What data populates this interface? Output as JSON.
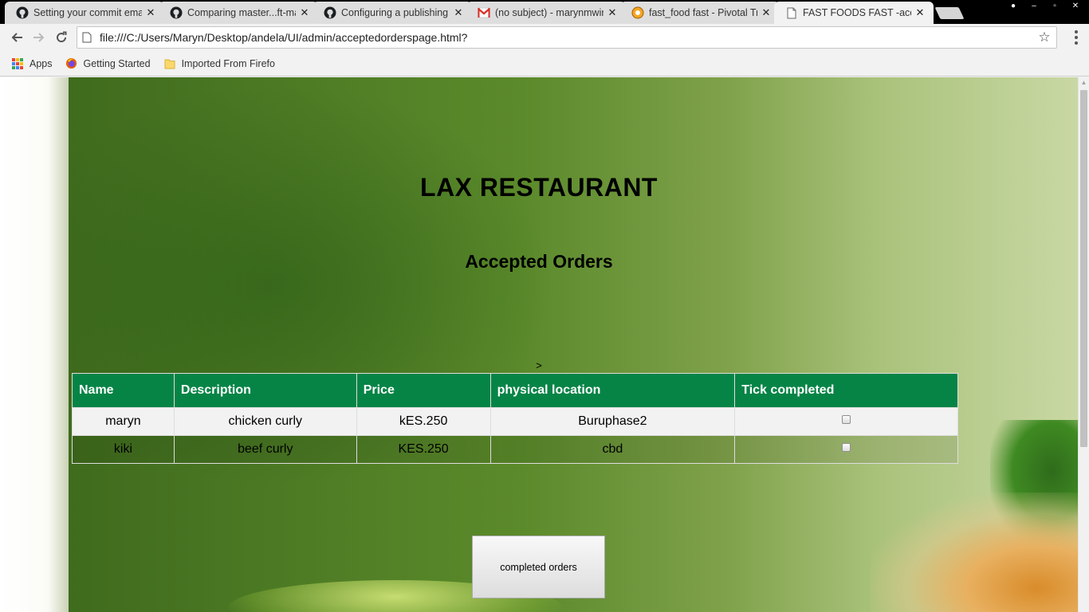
{
  "browser": {
    "tabs": [
      {
        "title": "Setting your commit ema",
        "icon": "github-icon"
      },
      {
        "title": "Comparing master...ft-ma",
        "icon": "github-icon"
      },
      {
        "title": "Configuring a publishing",
        "icon": "github-icon"
      },
      {
        "title": "(no subject) - marynmwir",
        "icon": "gmail-icon"
      },
      {
        "title": "fast_food fast - Pivotal Tr",
        "icon": "pivotal-icon"
      },
      {
        "title": "FAST FOODS FAST -acce",
        "icon": "page-icon"
      }
    ],
    "url": "file:///C:/Users/Maryn/Desktop/andela/UI/admin/acceptedorderspage.html?",
    "bookmarks": [
      {
        "label": "Apps",
        "icon": "apps-grid-icon"
      },
      {
        "label": "Getting Started",
        "icon": "firefox-icon"
      },
      {
        "label": "Imported From Firefo",
        "icon": "folder-icon"
      }
    ]
  },
  "page": {
    "site_title": "LAX RESTAURANT",
    "section_title": "Accepted Orders",
    "stray_text": ">",
    "table": {
      "headers": [
        "Name",
        "Description",
        "Price",
        "physical location",
        "Tick completed"
      ],
      "rows": [
        {
          "name": "maryn",
          "description": "chicken curly",
          "price": "kES.250",
          "location": "Buruphase2",
          "completed": false
        },
        {
          "name": "kiki",
          "description": "beef curly",
          "price": "KES.250",
          "location": "cbd",
          "completed": false
        }
      ]
    },
    "completed_button": "completed orders"
  },
  "colors": {
    "table_header": "#068446",
    "tab_strip": "#000000"
  }
}
